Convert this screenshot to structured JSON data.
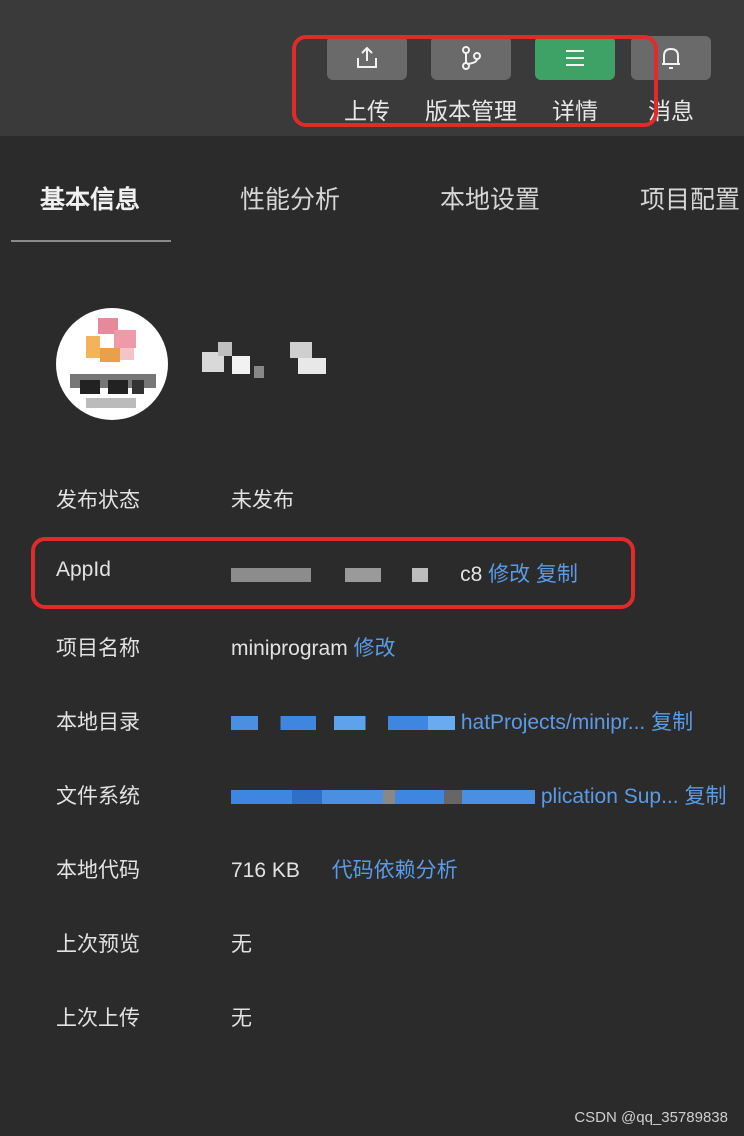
{
  "toolbar": {
    "items": [
      {
        "label": "上传",
        "icon": "upload-icon"
      },
      {
        "label": "版本管理",
        "icon": "branch-icon"
      },
      {
        "label": "详情",
        "icon": "menu-icon"
      },
      {
        "label": "消息",
        "icon": "bell-icon"
      }
    ],
    "active_color": "#3ea267",
    "button_color": "#6a6a6a"
  },
  "tabs": [
    "基本信息",
    "性能分析",
    "本地设置",
    "项目配置"
  ],
  "info": {
    "publish_status": {
      "label": "发布状态",
      "value": "未发布"
    },
    "appid": {
      "label": "AppId",
      "value_suffix": "c8",
      "edit": "修改",
      "copy": "复制"
    },
    "project_name": {
      "label": "项目名称",
      "value": "miniprogram",
      "edit": "修改"
    },
    "local_dir": {
      "label": "本地目录",
      "value": "hatProjects/minipr...",
      "copy": "复制"
    },
    "file_system": {
      "label": "文件系统",
      "value": "plication Sup...",
      "copy": "复制"
    },
    "local_code": {
      "label": "本地代码",
      "value": "716 KB",
      "link": "代码依赖分析"
    },
    "last_preview": {
      "label": "上次预览",
      "value": "无"
    },
    "last_upload": {
      "label": "上次上传",
      "value": "无"
    }
  },
  "colors": {
    "link": "#5b9be6",
    "highlight": "#e02b2b",
    "background": "#2b2b2b"
  },
  "watermark": "CSDN @qq_35789838"
}
